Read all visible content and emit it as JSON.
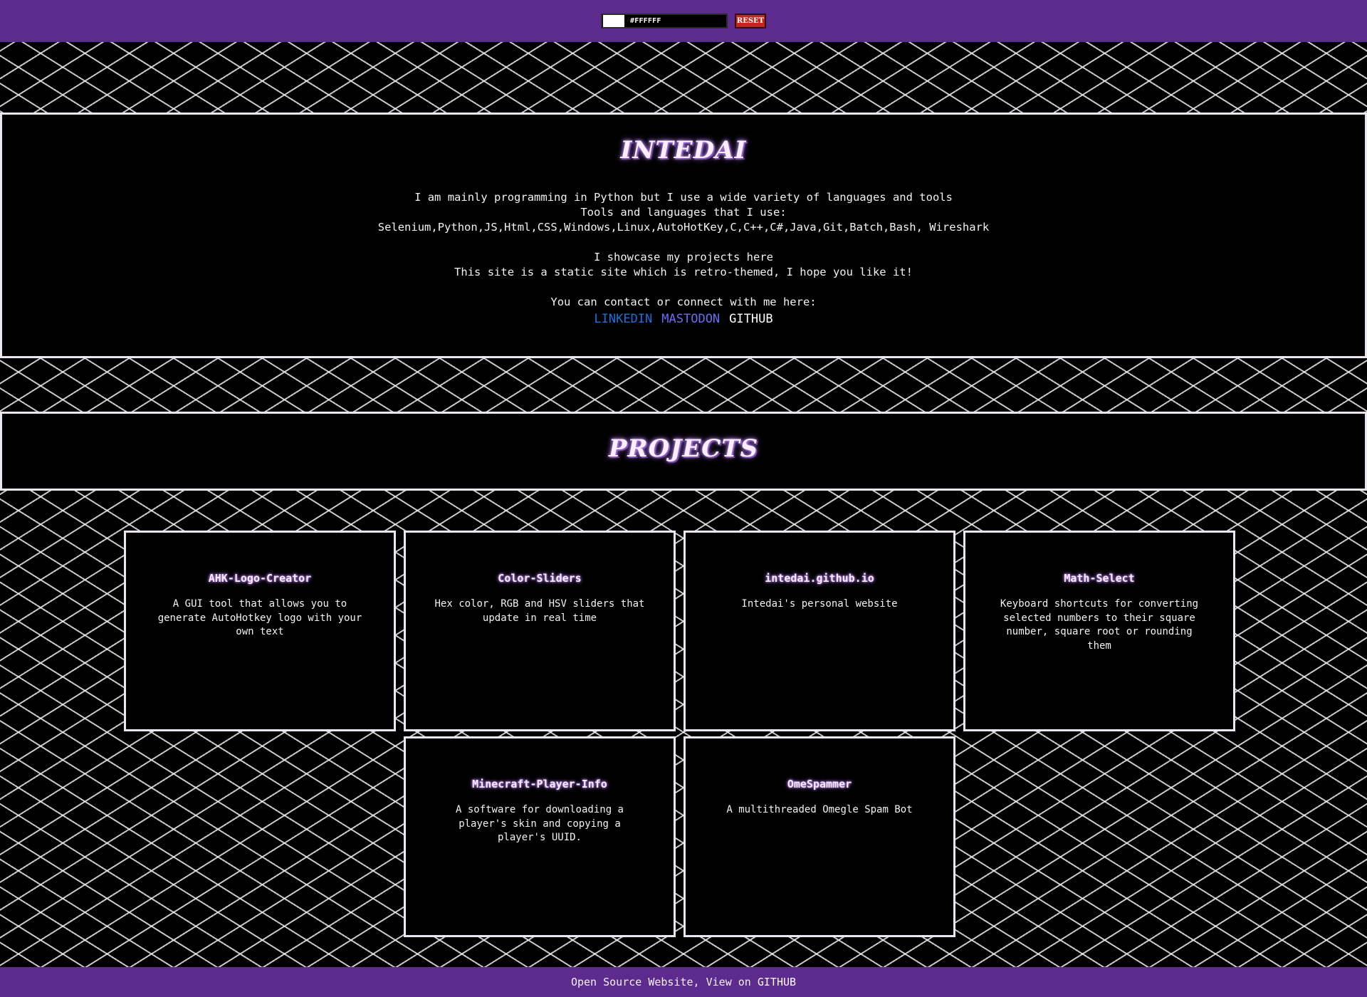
{
  "color_picker": {
    "hex_value": "#FFFFFF",
    "swatch_color": "#FFFFFF",
    "reset_label": "RESET",
    "reset_color": "#C0271F"
  },
  "theme": {
    "bar_color": "#5D2A8E",
    "background": "#000000",
    "grid_line_color": "#EBEBEB",
    "border_color": "#ECE6F2"
  },
  "about": {
    "title": "INTEDAI",
    "line1": "I am mainly programming in Python but I use a wide variety of languages and tools",
    "line2": "Tools and languages that I use:",
    "line3": "Selenium,Python,JS,Html,CSS,Windows,Linux,AutoHotKey,C,C++,C#,Java,Git,Batch,Bash, Wireshark",
    "line4": "I showcase my projects here",
    "line5": "This site is a static site which is retro-themed, I hope you like it!",
    "line6": "You can contact or connect with me here:",
    "links": {
      "linkedin": "LINKEDIN",
      "mastodon": "MASTODON",
      "github": "GITHUB"
    }
  },
  "projects": {
    "title": "PROJECTS",
    "items": [
      {
        "name": "AHK-Logo-Creator",
        "description": "A GUI tool that allows you to generate AutoHotkey logo with your own text"
      },
      {
        "name": "Color-Sliders",
        "description": "Hex color, RGB and HSV sliders that update in real time"
      },
      {
        "name": "intedai.github.io",
        "description": "Intedai's personal website"
      },
      {
        "name": "Math-Select",
        "description": "Keyboard shortcuts for converting selected numbers to their square number, square root or rounding them"
      },
      {
        "name": "Minecraft-Player-Info",
        "description": "A software for downloading a player's skin and copying a player's UUID."
      },
      {
        "name": "OmeSpammer",
        "description": "A multithreaded Omegle Spam Bot"
      }
    ]
  },
  "footer": {
    "prefix": "Open Source Website, View on ",
    "link": "GITHUB"
  }
}
